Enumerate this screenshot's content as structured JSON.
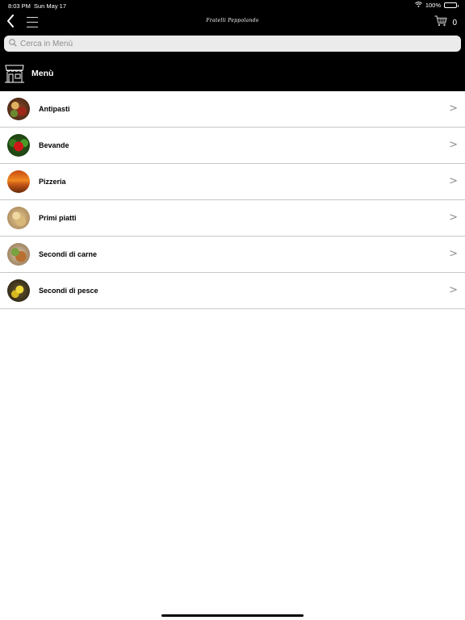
{
  "status_bar": {
    "time": "8:03 PM",
    "date": "Sun May 17",
    "battery": "100%",
    "battery_level": 1.0
  },
  "header": {
    "brand": "Fratelli Peppolando",
    "cart_count": "0",
    "icons": {
      "back": "chevron-left-icon",
      "menu": "hamburger-menu-icon",
      "cart": "shopping-cart-icon"
    }
  },
  "search": {
    "placeholder": "Cerca in Menù",
    "value": ""
  },
  "section": {
    "title": "Menù",
    "icon": "storefront-icon"
  },
  "categories": [
    {
      "label": "Antipasti"
    },
    {
      "label": "Bevande"
    },
    {
      "label": "Pizzeria"
    },
    {
      "label": "Primi piatti"
    },
    {
      "label": "Secondi di carne"
    },
    {
      "label": "Secondi di pesce"
    }
  ],
  "chevron": ">",
  "colors": {
    "header_bg": "#000000",
    "search_bg": "#ebebeb",
    "divider": "#c8c8c8",
    "chevron": "#8e8e93"
  }
}
